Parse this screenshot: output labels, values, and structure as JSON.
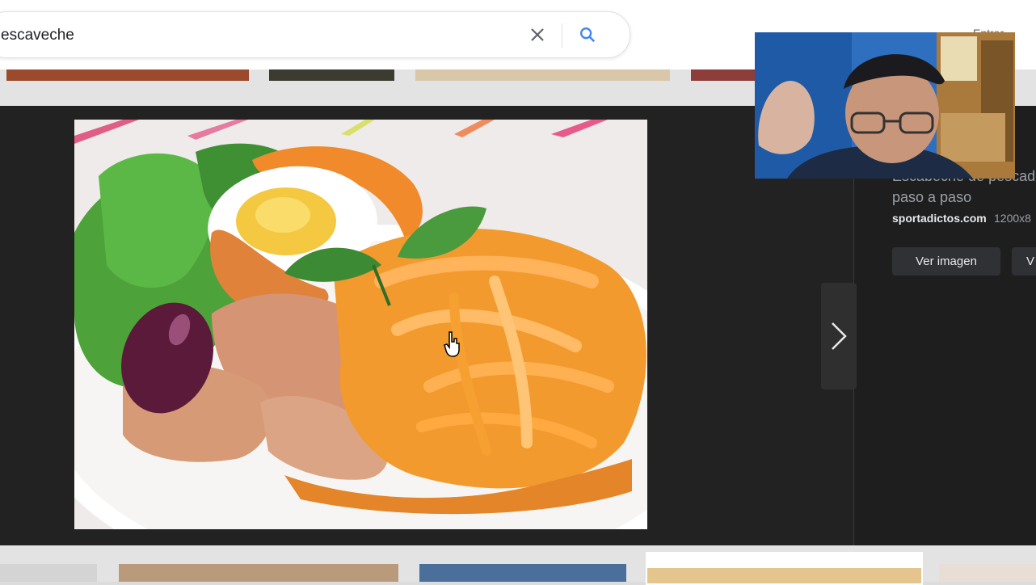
{
  "search": {
    "query": "escaveche",
    "signin_label": "Entrar"
  },
  "icons": {
    "clear": "close-icon",
    "search": "search-icon",
    "next": "chevron-right-icon"
  },
  "preview": {
    "title_line1": "Escabeche de pescado",
    "title_line2": "paso a paso",
    "source": "sportadictos.com",
    "dimensions": "1200x8",
    "view_image_label": "Ver imagen",
    "second_button_label": "V"
  },
  "colors": {
    "search_accent": "#4285f4",
    "panel_bg": "#222222"
  }
}
